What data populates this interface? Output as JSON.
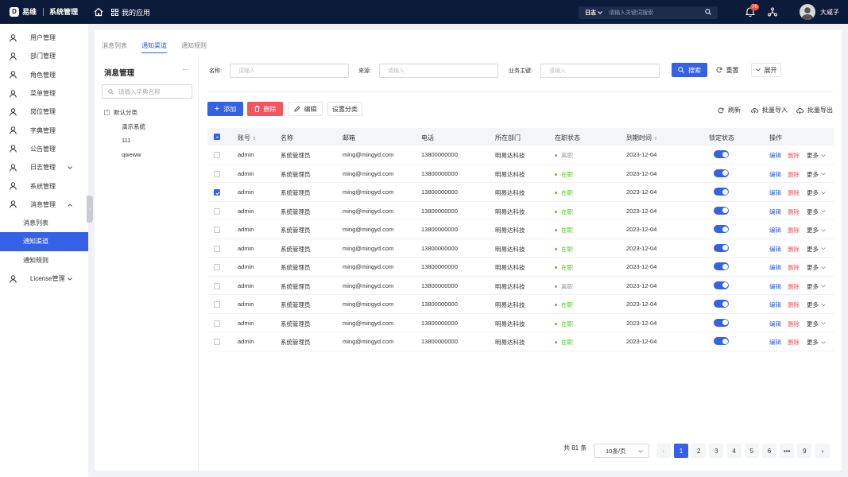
{
  "header": {
    "logo_mark": "D",
    "brand": "易维",
    "system": "系统管理",
    "apps_label": "我的应用",
    "search_select": "日志",
    "search_placeholder": "请输入关键词搜索",
    "notify_count": "76",
    "user_name": "大咸子"
  },
  "sidebar": {
    "items": [
      {
        "label": "用户管理",
        "icon": "user-icon"
      },
      {
        "label": "部门管理",
        "icon": "user-icon"
      },
      {
        "label": "角色管理",
        "icon": "user-icon"
      },
      {
        "label": "菜单管理",
        "icon": "user-icon"
      },
      {
        "label": "岗位管理",
        "icon": "user-icon"
      },
      {
        "label": "字典管理",
        "icon": "user-icon"
      },
      {
        "label": "公告管理",
        "icon": "user-icon"
      },
      {
        "label": "日志管理",
        "icon": "user-icon",
        "expand": "down"
      },
      {
        "label": "系统管理",
        "icon": "user-icon"
      },
      {
        "label": "消息管理",
        "icon": "user-icon",
        "expand": "up"
      },
      {
        "label": "消息列表",
        "sub": true
      },
      {
        "label": "通知渠道",
        "sub": true,
        "active": true
      },
      {
        "label": "通知规则",
        "sub": true
      },
      {
        "label": "License管理",
        "icon": "user-icon",
        "expand": "down"
      }
    ]
  },
  "tabs": [
    "消息列表",
    "通知渠道",
    "通知规则"
  ],
  "tree": {
    "title": "消息管理",
    "more": "···",
    "search_placeholder": "请输入字典名称",
    "root": "默认分类",
    "children": [
      "演示系统",
      "111",
      "qweww"
    ]
  },
  "filters": {
    "name_label": "名称:",
    "name_placeholder": "请输入",
    "source_label": "来源:",
    "source_placeholder": "请输入",
    "key_label": "业务主键:",
    "key_placeholder": "请输入",
    "search_btn": "搜索",
    "reset_btn": "重置",
    "expand_btn": "展开"
  },
  "toolbar": {
    "add": "添加",
    "delete": "删除",
    "edit": "编辑",
    "set_category": "设置分类",
    "refresh": "刷新",
    "import": "批量导入",
    "export": "批量导出"
  },
  "table": {
    "columns": [
      "账号",
      "名称",
      "邮箱",
      "电话",
      "所在部门",
      "在职状态",
      "到期时间",
      "锁定状态",
      "操作"
    ],
    "op_edit": "编辑",
    "op_delete": "删除",
    "op_more": "更多",
    "rows": [
      {
        "account": "admin",
        "name": "系统管理员",
        "email": "ming@mingyd.com",
        "phone": "13800000000",
        "dept": "明易达科技",
        "status": "离职",
        "status_color": "#999999",
        "expire": "2023-12-04",
        "checked": false
      },
      {
        "account": "admin",
        "name": "系统管理员",
        "email": "ming@mingyd.com",
        "phone": "13800000000",
        "dept": "明易达科技",
        "status": "在职",
        "status_color": "#52c41a",
        "expire": "2023-12-04",
        "checked": false
      },
      {
        "account": "admin",
        "name": "系统管理员",
        "email": "ming@mingyd.com",
        "phone": "13800000000",
        "dept": "明易达科技",
        "status": "在职",
        "status_color": "#52c41a",
        "expire": "2023-12-04",
        "checked": true
      },
      {
        "account": "admin",
        "name": "系统管理员",
        "email": "ming@mingyd.com",
        "phone": "13800000000",
        "dept": "明易达科技",
        "status": "在职",
        "status_color": "#52c41a",
        "expire": "2023-12-04",
        "checked": false
      },
      {
        "account": "admin",
        "name": "系统管理员",
        "email": "ming@mingyd.com",
        "phone": "13800000000",
        "dept": "明易达科技",
        "status": "在职",
        "status_color": "#52c41a",
        "expire": "2023-12-04",
        "checked": false
      },
      {
        "account": "admin",
        "name": "系统管理员",
        "email": "ming@mingyd.com",
        "phone": "13800000000",
        "dept": "明易达科技",
        "status": "在职",
        "status_color": "#52c41a",
        "expire": "2023-12-04",
        "checked": false
      },
      {
        "account": "admin",
        "name": "系统管理员",
        "email": "ming@mingyd.com",
        "phone": "13800000000",
        "dept": "明易达科技",
        "status": "在职",
        "status_color": "#52c41a",
        "expire": "2023-12-04",
        "checked": false
      },
      {
        "account": "admin",
        "name": "系统管理员",
        "email": "ming@mingyd.com",
        "phone": "13800000000",
        "dept": "明易达科技",
        "status": "离职",
        "status_color": "#999999",
        "expire": "2023-12-04",
        "checked": false
      },
      {
        "account": "admin",
        "name": "系统管理员",
        "email": "ming@mingyd.com",
        "phone": "13800000000",
        "dept": "明易达科技",
        "status": "在职",
        "status_color": "#52c41a",
        "expire": "2023-12-04",
        "checked": false
      },
      {
        "account": "admin",
        "name": "系统管理员",
        "email": "ming@mingyd.com",
        "phone": "13800000000",
        "dept": "明易达科技",
        "status": "在职",
        "status_color": "#52c41a",
        "expire": "2023-12-04",
        "checked": false
      },
      {
        "account": "admin",
        "name": "系统管理员",
        "email": "ming@mingyd.com",
        "phone": "13800000000",
        "dept": "明易达科技",
        "status": "在职",
        "status_color": "#52c41a",
        "expire": "2023-12-04",
        "checked": false
      }
    ]
  },
  "pagination": {
    "total": "共 81 条",
    "page_size": "10条/页",
    "pages": [
      "1",
      "2",
      "3",
      "4",
      "5",
      "6",
      "•••",
      "9"
    ],
    "current": "1",
    "prev": "‹",
    "next": "›"
  },
  "colors": {
    "primary": "#3461e6",
    "danger": "#f5535e",
    "topbar": "#0c1b3a"
  }
}
